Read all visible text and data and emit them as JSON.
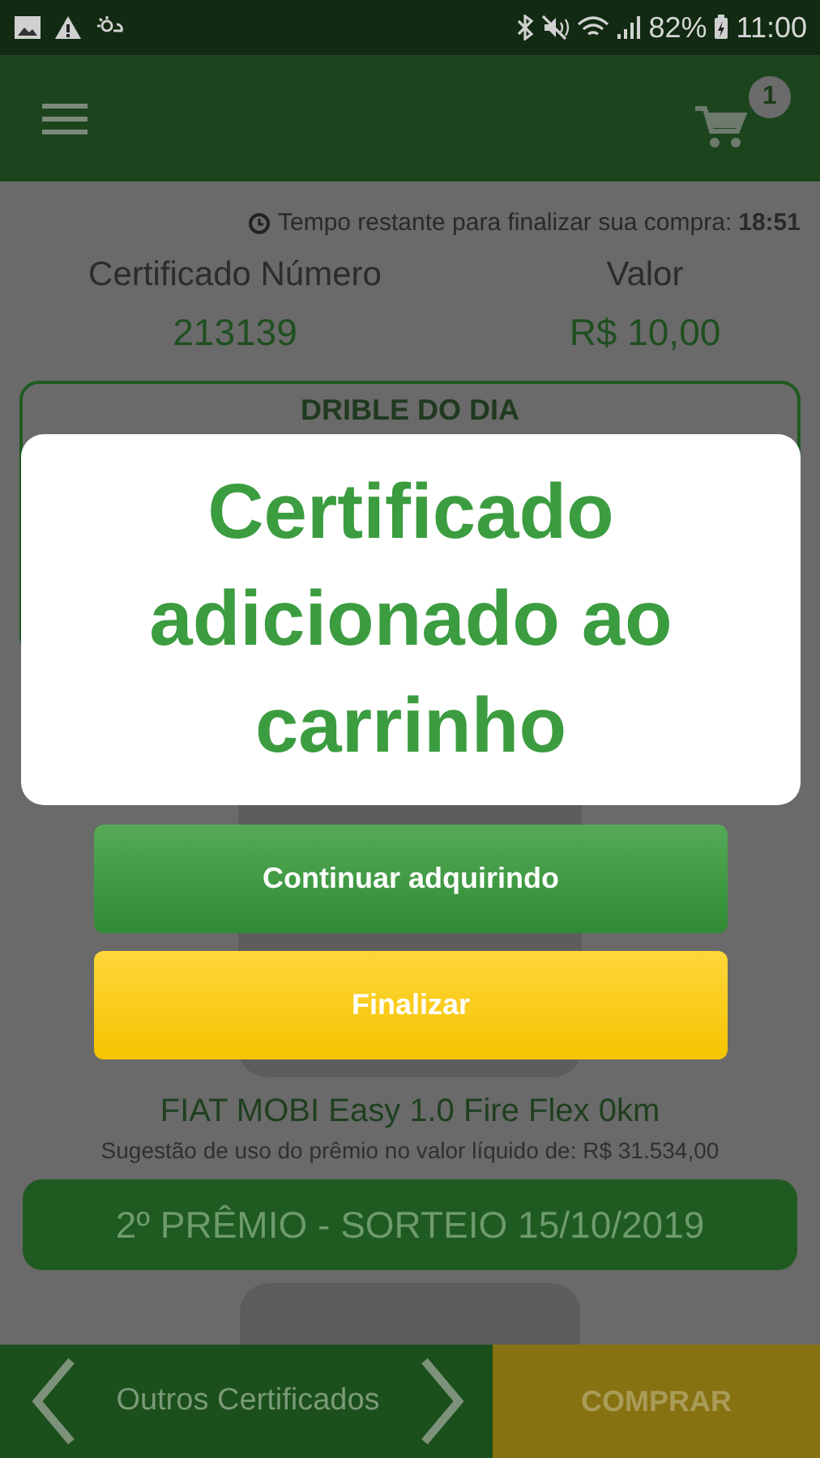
{
  "status_bar": {
    "battery": "82%",
    "time": "11:00"
  },
  "app_bar": {
    "cart_count": "1"
  },
  "timer": {
    "label": "Tempo restante para finalizar sua compra:",
    "value": "18:51"
  },
  "certificate": {
    "number_label": "Certificado Número",
    "number": "213139",
    "value_label": "Valor",
    "value": "R$ 10,00"
  },
  "section_title": "DRIBLE DO DIA",
  "prize": {
    "name": "FIAT MOBI Easy 1.0 Fire Flex 0km",
    "suggestion": "Sugestão de uso do prêmio no valor líquido de: R$ 31.534,00"
  },
  "prize_banner": "2º PRÊMIO - SORTEIO 15/10/2019",
  "dialog": {
    "message": "Certificado adicionado ao carrinho",
    "buttons": [
      {
        "label": "Continuar adquirindo",
        "kind": "primary"
      },
      {
        "label": "Finalizar",
        "kind": "secondary"
      }
    ]
  },
  "bottom_bar": {
    "nav_label": "Outros Certificados",
    "buy": "COMPRAR"
  }
}
